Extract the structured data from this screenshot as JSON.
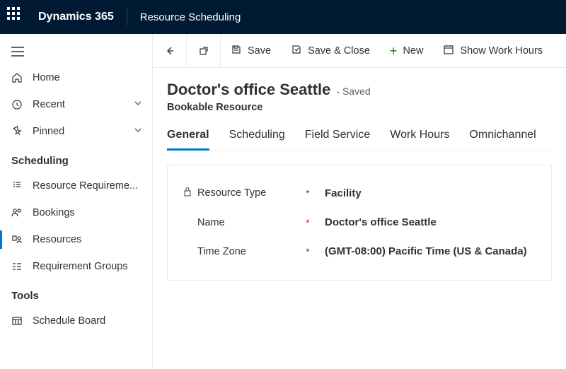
{
  "topbar": {
    "brand": "Dynamics 365",
    "area": "Resource Scheduling"
  },
  "sidebar": {
    "home": "Home",
    "recent": "Recent",
    "pinned": "Pinned",
    "section_scheduling": "Scheduling",
    "resource_requirements": "Resource Requireme...",
    "bookings": "Bookings",
    "resources": "Resources",
    "requirement_groups": "Requirement Groups",
    "section_tools": "Tools",
    "schedule_board": "Schedule Board"
  },
  "commands": {
    "save": "Save",
    "save_close": "Save & Close",
    "new": "New",
    "show_work_hours": "Show Work Hours"
  },
  "record": {
    "title": "Doctor's office Seattle",
    "status": "- Saved",
    "entity": "Bookable Resource"
  },
  "tabs": {
    "general": "General",
    "scheduling": "Scheduling",
    "field_service": "Field Service",
    "work_hours": "Work Hours",
    "omnichannel": "Omnichannel"
  },
  "fields": {
    "resource_type_label": "Resource Type",
    "resource_type_value": "Facility",
    "name_label": "Name",
    "name_value": "Doctor's office Seattle",
    "timezone_label": "Time Zone",
    "timezone_value": "(GMT-08:00) Pacific Time (US & Canada)"
  }
}
